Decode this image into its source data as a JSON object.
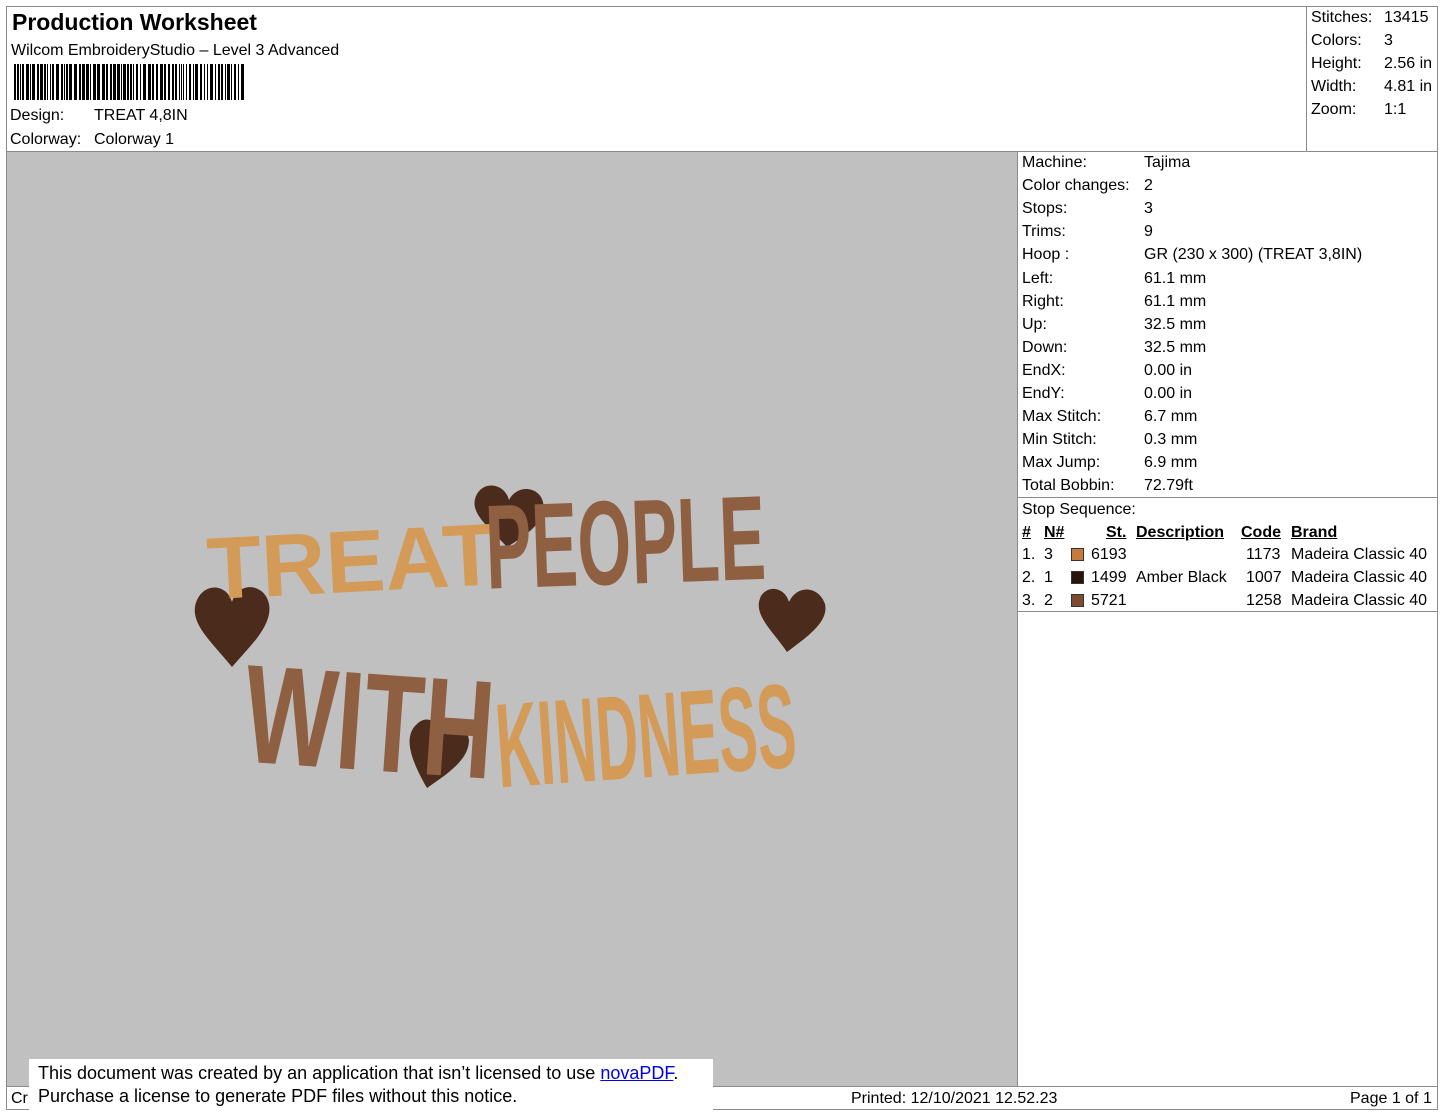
{
  "header": {
    "title": "Production Worksheet",
    "software": "Wilcom EmbroideryStudio – Level 3 Advanced",
    "design_label": "Design:",
    "design_value": "TREAT 4,8IN",
    "colorway_label": "Colorway:",
    "colorway_value": "Colorway 1"
  },
  "summary": [
    {
      "label": "Stitches:",
      "value": "13415"
    },
    {
      "label": "Colors:",
      "value": "3"
    },
    {
      "label": "Height:",
      "value": "2.56 in"
    },
    {
      "label": "Width:",
      "value": "4.81 in"
    },
    {
      "label": "Zoom:",
      "value": "1:1"
    }
  ],
  "machine_info": [
    {
      "label": "Machine:",
      "value": "Tajima"
    },
    {
      "label": "Color changes:",
      "value": "2"
    },
    {
      "label": "Stops:",
      "value": "3"
    },
    {
      "label": "Trims:",
      "value": "9"
    },
    {
      "label": "Hoop :",
      "value": "GR (230 x 300) (TREAT 3,8IN)"
    },
    {
      "label": "Left:",
      "value": "61.1 mm"
    },
    {
      "label": "Right:",
      "value": "61.1 mm"
    },
    {
      "label": "Up:",
      "value": "32.5 mm"
    },
    {
      "label": "Down:",
      "value": "32.5 mm"
    },
    {
      "label": "EndX:",
      "value": "0.00 in"
    },
    {
      "label": "EndY:",
      "value": "0.00 in"
    },
    {
      "label": "Max Stitch:",
      "value": "6.7 mm"
    },
    {
      "label": "Min Stitch:",
      "value": "0.3 mm"
    },
    {
      "label": "Max Jump:",
      "value": "6.9 mm"
    },
    {
      "label": "Total Bobbin:",
      "value": "72.79ft"
    }
  ],
  "stop_sequence": {
    "title": "Stop Sequence:",
    "headers": [
      "#",
      "N#",
      "St.",
      "Description",
      "Code",
      "Brand"
    ],
    "rows": [
      {
        "num": "1.",
        "n": "3",
        "color": "#c87a3e",
        "st": "6193",
        "description": "",
        "code": "1173",
        "brand": "Madeira Classic 40"
      },
      {
        "num": "2.",
        "n": "1",
        "color": "#2a140c",
        "st": "1499",
        "description": "Amber Black",
        "code": "1007",
        "brand": "Madeira Classic 40"
      },
      {
        "num": "3.",
        "n": "2",
        "color": "#7e4a30",
        "st": "5721",
        "description": "",
        "code": "1258",
        "brand": "Madeira Classic 40"
      }
    ]
  },
  "design_preview": {
    "line1a": "TREAT",
    "line1b": "PEOPLE",
    "line2a": "WITH",
    "line2b": "KINDNESS",
    "colors": {
      "tan": "#d39a58",
      "medium": "#8f5f42",
      "dark": "#4a2b1c"
    }
  },
  "notice": {
    "line1_prefix": "This document was created by an application that isn’t licensed to use ",
    "link": "novaPDF",
    "line1_suffix": ".",
    "line2": "Purchase a license to generate PDF files without this notice."
  },
  "footer": {
    "left": "Cr",
    "printed": "Printed: 12/10/2021 12.52.23",
    "page": "Page 1 of 1"
  }
}
